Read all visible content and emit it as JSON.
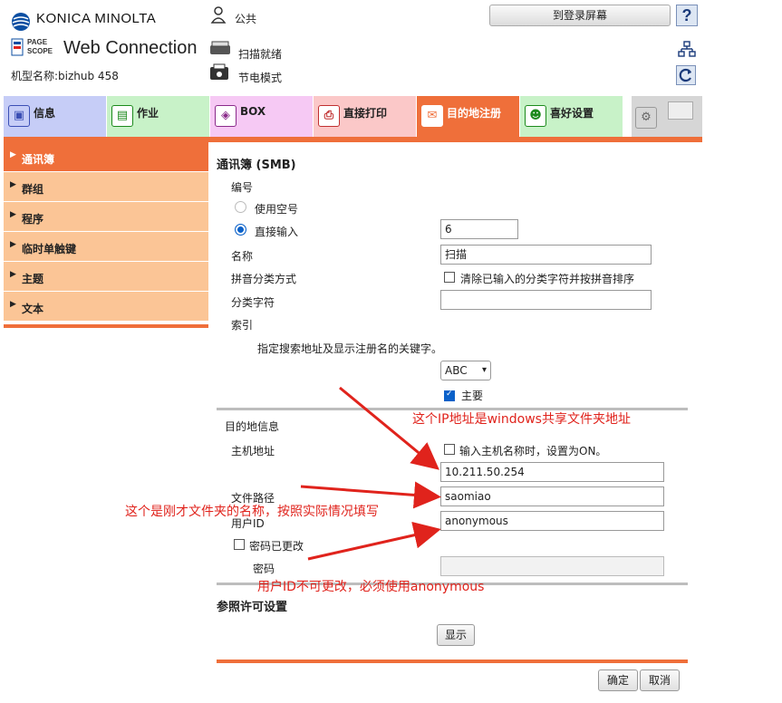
{
  "header": {
    "brand": "KONICA MINOLTA",
    "logo_small": "PAGE SCOPE",
    "logo_text": "Web Connection",
    "model_label": "机型名称:bizhub 458",
    "user": "公共",
    "scan_status": "扫描就绪",
    "power_status": "节电模式",
    "login_button": "到登录屏幕",
    "help": "?"
  },
  "tabs": [
    {
      "label": "信息",
      "color": "#c6cdf7"
    },
    {
      "label": "作业",
      "color": "#c8f2c8"
    },
    {
      "label": "BOX",
      "color": "#f6c9f4"
    },
    {
      "label": "直接打印",
      "color": "#fbc8c8"
    },
    {
      "label": "目的地注册",
      "color": "#ef6f3a"
    },
    {
      "label": "喜好设置",
      "color": "#c8f2c8"
    }
  ],
  "sidebar": {
    "items": [
      {
        "label": "通讯簿",
        "active": true
      },
      {
        "label": "群组"
      },
      {
        "label": "程序"
      },
      {
        "label": "临时单触键"
      },
      {
        "label": "主题"
      },
      {
        "label": "文本"
      }
    ]
  },
  "form": {
    "title": "通讯簿 (SMB)",
    "number_label": "编号",
    "use_free_label": "使用空号",
    "direct_input_label": "直接输入",
    "number_value": "6",
    "name_label": "名称",
    "name_value": "扫描",
    "pinyin_label": "拼音分类方式",
    "pinyin_option": "清除已输入的分类字符并按拼音排序",
    "category_label": "分类字符",
    "category_value": "",
    "index_label": "索引",
    "index_desc": "指定搜索地址及显示注册名的关键字。",
    "index_select": "ABC",
    "main_label": "主要",
    "dest_info_label": "目的地信息",
    "host_label": "主机地址",
    "host_option": "输入主机名称时，设置为ON。",
    "host_value": "10.211.50.254",
    "path_label": "文件路径",
    "path_value": "saomiao",
    "userid_label": "用户ID",
    "userid_value": "anonymous",
    "pwd_changed_label": "密码已更改",
    "pwd_label": "密码",
    "pwd_value": "",
    "ref_label": "参照许可设置",
    "show_button": "显示",
    "ok_button": "确定",
    "cancel_button": "取消"
  },
  "annotations": {
    "ip_note": "这个IP地址是windows共享文件夹地址",
    "path_note": "这个是刚才文件夹的名称，按照实际情况填写",
    "user_note": "用户ID不可更改，必须使用anonymous"
  },
  "colors": {
    "accent": "#ef6f3a",
    "annotation": "#e0231c"
  }
}
